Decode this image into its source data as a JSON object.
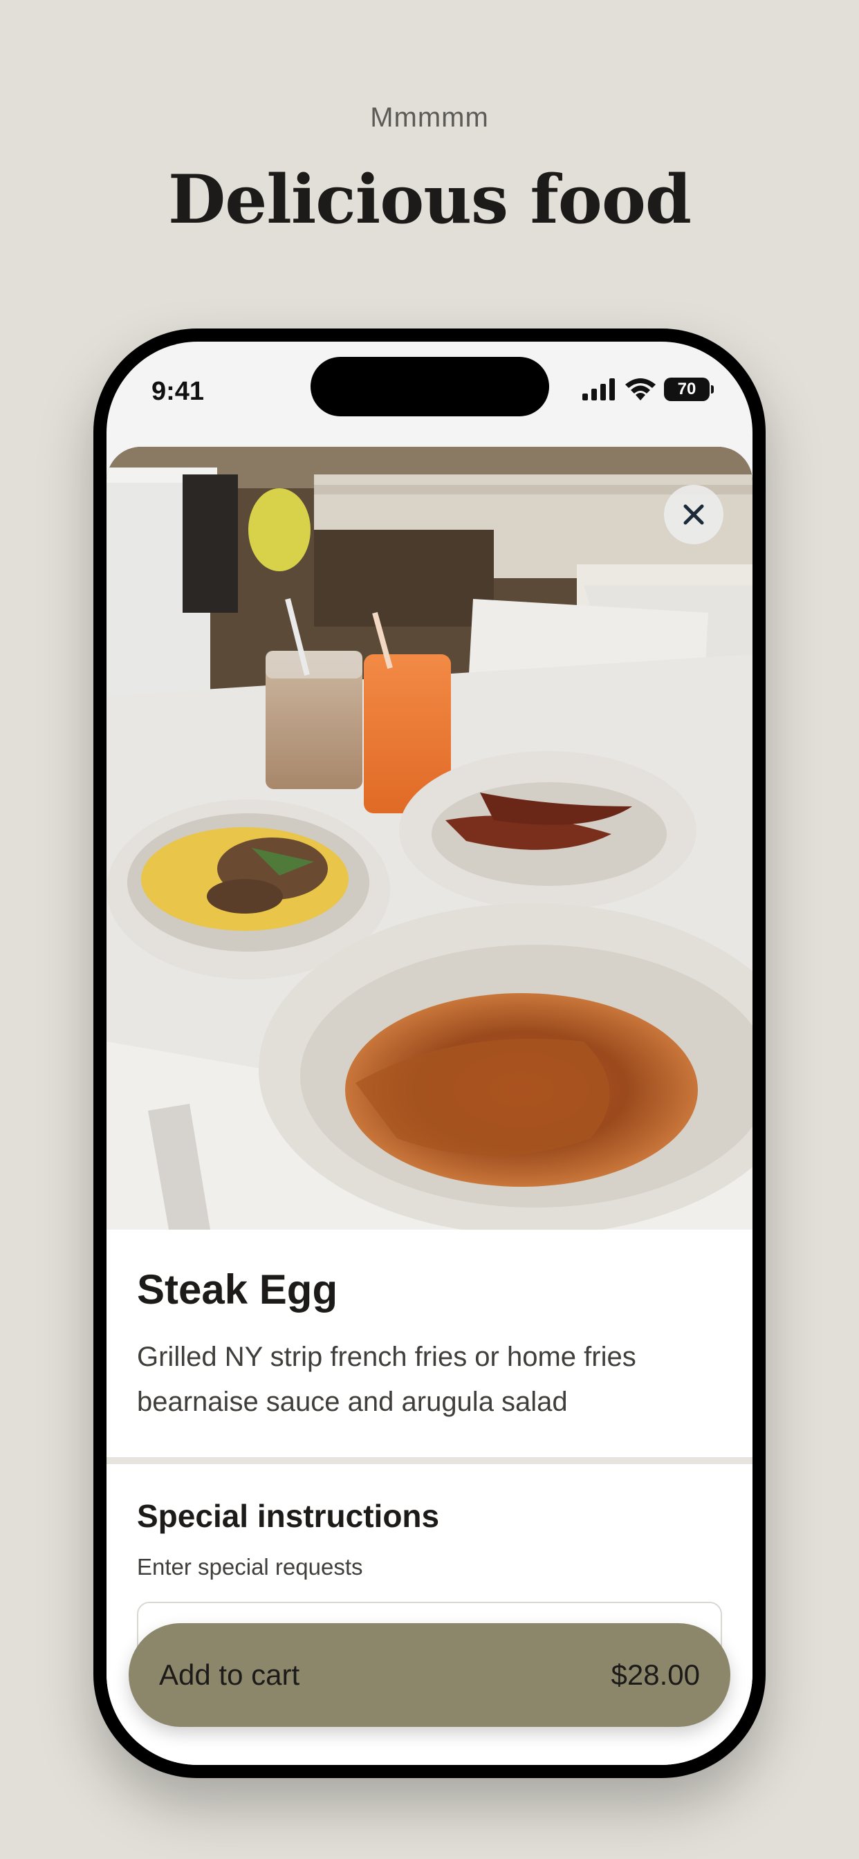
{
  "page": {
    "eyebrow": "Mmmmm",
    "headline": "Delicious food"
  },
  "status_bar": {
    "time": "9:41",
    "battery": "70"
  },
  "item": {
    "title": "Steak Egg",
    "description": "Grilled NY strip french fries or home fries bearnaise sauce and arugula salad"
  },
  "instructions": {
    "title": "Special instructions",
    "subtitle": "Enter special requests",
    "value": ""
  },
  "cart": {
    "label": "Add to cart",
    "price": "$28.00"
  },
  "colors": {
    "background": "#e2dfd8",
    "cart_button": "#8c876a",
    "text_dark": "#1c1b19"
  }
}
